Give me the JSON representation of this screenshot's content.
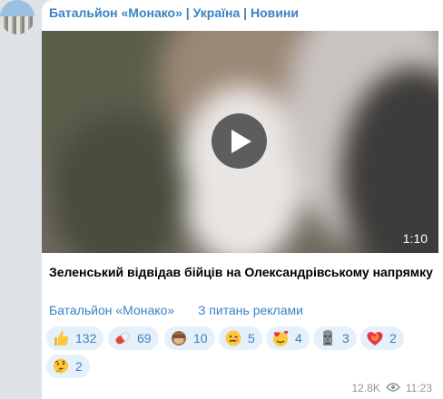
{
  "channel": {
    "title": "Батальйон «Монако» | Україна | Новини"
  },
  "post": {
    "video_duration": "1:10",
    "caption": "Зеленський відвідав бійців на Олександрівському напрямку"
  },
  "footer_links": {
    "channel_link": "Батальйон «Монако»",
    "ads_link": "З питань реклами"
  },
  "reactions": [
    {
      "icon": "thumbs-up-icon",
      "count": "132"
    },
    {
      "icon": "pill-icon",
      "count": "69"
    },
    {
      "icon": "see-no-evil-monkey-icon",
      "count": "10"
    },
    {
      "icon": "woozy-face-icon",
      "count": "5"
    },
    {
      "icon": "smiling-face-with-hearts-icon",
      "count": "4"
    },
    {
      "icon": "moai-icon",
      "count": "3"
    },
    {
      "icon": "heart-on-fire-icon",
      "count": "2"
    },
    {
      "icon": "thinking-face-icon",
      "count": "2"
    }
  ],
  "meta": {
    "views": "12.8K",
    "time": "11:23"
  },
  "colors": {
    "accent": "#3a82c4",
    "reaction_bg": "#e6f0fa",
    "chat_bg": "#dfe3e7"
  }
}
